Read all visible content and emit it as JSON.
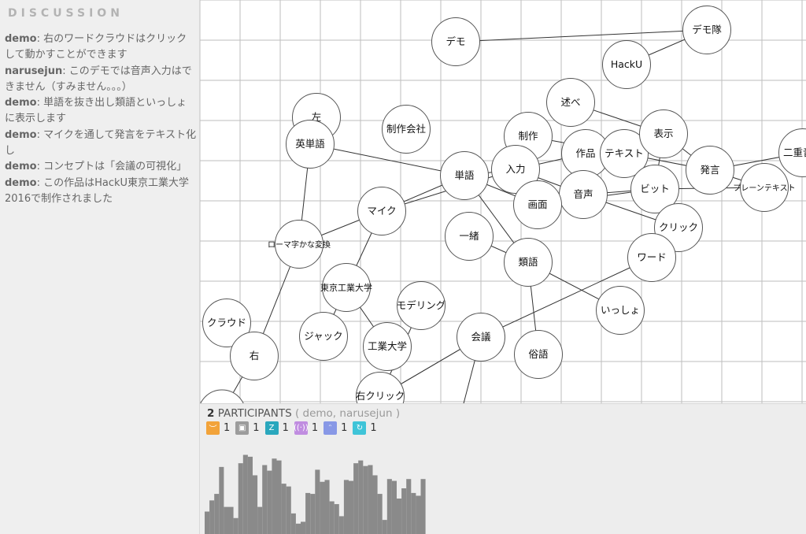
{
  "sidebar": {
    "title": "DISCUSSION",
    "messages": [
      {
        "author": "demo",
        "text": "右のワードクラウドはクリックして動かすことができます"
      },
      {
        "author": "narusejun",
        "text": "このデモでは音声入力はできません（すみません。。。）"
      },
      {
        "author": "demo",
        "text": "単語を抜き出し類語といっしょに表示します"
      },
      {
        "author": "demo",
        "text": "マイクを通して発言をテキスト化し"
      },
      {
        "author": "demo",
        "text": "コンセプトは「会議の可視化」"
      },
      {
        "author": "demo",
        "text": "この作品はHackU東京工業大学2016で制作されました"
      }
    ]
  },
  "graph": {
    "nodes": [
      "デモ",
      "デモ隊",
      "HackU",
      "述べ",
      "左",
      "英単語",
      "制作会社",
      "制作",
      "作品",
      "テキスト",
      "表示",
      "入力",
      "単語",
      "発言",
      "二重音声",
      "プレーンテキスト",
      "ビット",
      "音声",
      "画面",
      "マイク",
      "ローマ字かな変換",
      "一緒",
      "クリック",
      "ワード",
      "類語",
      "東京工業大学",
      "モデリング",
      "いっしょ",
      "クラウド",
      "ジャック",
      "工業大学",
      "会議",
      "俗語",
      "右",
      "右クリック"
    ]
  },
  "footer": {
    "participants_count": "2",
    "participants_label": " PARTICIPANTS",
    "participants_names": " ( demo, narusejun )",
    "avatars": [
      {
        "icon": "orange-face-icon",
        "color": "#f2a33a",
        "count": "1"
      },
      {
        "icon": "gray-face-icon",
        "color": "#9c9c9c",
        "count": "1"
      },
      {
        "icon": "teal-z-icon",
        "color": "#2aa7bd",
        "count": "1"
      },
      {
        "icon": "purple-wave-icon",
        "color": "#c08de0",
        "count": "1"
      },
      {
        "icon": "blue-face-icon",
        "color": "#8898e6",
        "count": "1"
      },
      {
        "icon": "cyan-loop-icon",
        "color": "#3fc4d8",
        "count": "1"
      }
    ],
    "activity_levels": [
      0.25,
      0.37,
      0.44,
      0.73,
      0.3,
      0.3,
      0.18,
      0.77,
      0.86,
      0.84,
      0.64,
      0.3,
      0.75,
      0.69,
      0.82,
      0.8,
      0.55,
      0.52,
      0.23,
      0.12,
      0.14,
      0.45,
      0.44,
      0.7,
      0.57,
      0.59,
      0.36,
      0.33,
      0.2,
      0.59,
      0.58,
      0.77,
      0.8,
      0.74,
      0.75,
      0.64,
      0.44,
      0.16,
      0.6,
      0.58,
      0.39,
      0.5,
      0.6,
      0.45,
      0.42,
      0.6
    ]
  }
}
